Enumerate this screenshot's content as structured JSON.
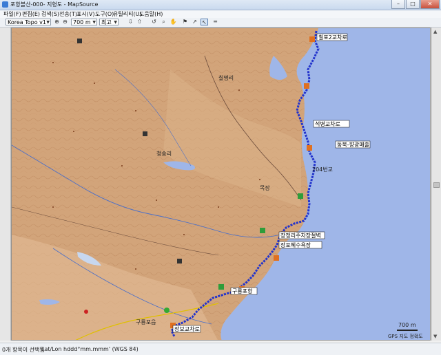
{
  "window": {
    "title": "포항블산-000- 지형도 - MapSource",
    "minimize": "–",
    "maximize": "□",
    "close": "✕"
  },
  "menu": [
    "파일(F)",
    "편집(E)",
    "검색(S)",
    "전송(T)",
    "표시(V)",
    "도구(O)",
    "유틸리티(U)",
    "도움말(H)"
  ],
  "toolbar": {
    "map_product": "Korea Topo v1",
    "zoom_level": "700 m",
    "detail": "최고"
  },
  "map": {
    "sea_color": "#9fb6e8",
    "land_color": "#d2a47a",
    "track_color": "#2233cc",
    "waypoint_labels": [
      "칠포2교차로",
      "석병교차로",
      "동북-향광매출",
      "장정리주차장절벽",
      "장포혜수욕장",
      "구룡포항",
      "장보교차로"
    ],
    "place_labels": [
      "204번교",
      "칠명리",
      "청송리",
      "구룡포읍",
      "목장"
    ],
    "scale_text": "700 m",
    "credit": "GPS 지도 정확도"
  },
  "status": {
    "selection": "0개 항목이 선택됨",
    "position": "Lat/Lon hddd°mm.mmm' (WGS 84)"
  }
}
